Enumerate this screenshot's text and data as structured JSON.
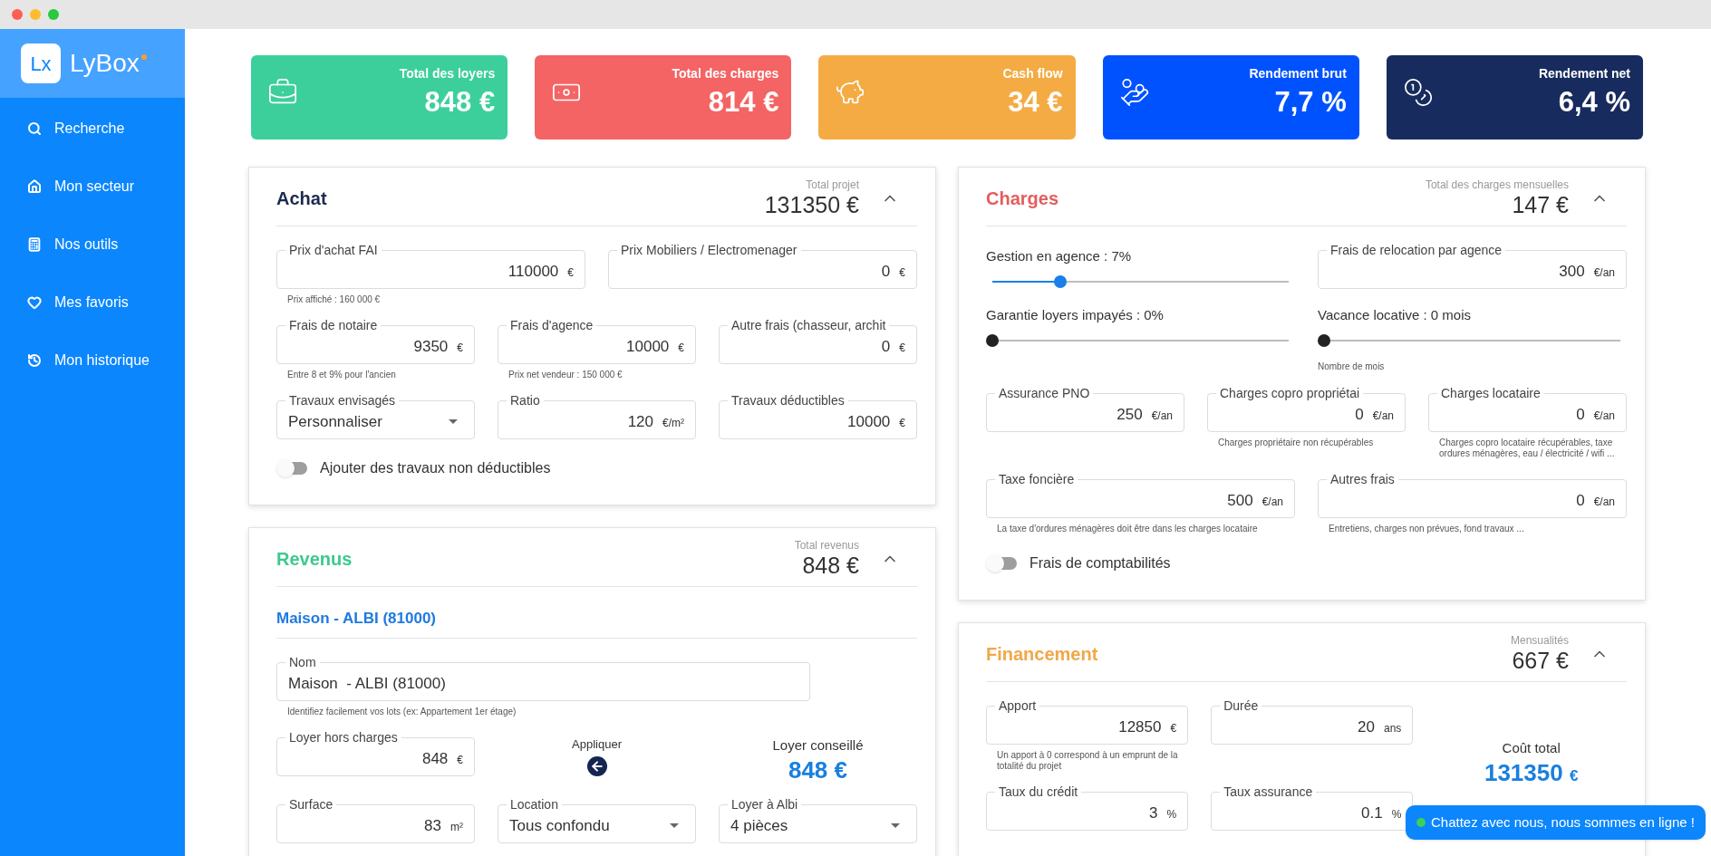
{
  "sidebar": {
    "logo": {
      "mark": "Lx",
      "name": "LyBox"
    },
    "items": [
      {
        "label": "Recherche"
      },
      {
        "label": "Mon secteur"
      },
      {
        "label": "Nos outils"
      },
      {
        "label": "Mes favoris"
      },
      {
        "label": "Mon historique"
      }
    ]
  },
  "kpis": [
    {
      "label": "Total des loyers",
      "value": "848 €",
      "color": "#3ccf9c"
    },
    {
      "label": "Total des charges",
      "value": "814 €",
      "color": "#f46464"
    },
    {
      "label": "Cash flow",
      "value": "34 €",
      "color": "#f4ab43"
    },
    {
      "label": "Rendement brut",
      "value": "7,7 %",
      "color": "#0052ff"
    },
    {
      "label": "Rendement net",
      "value": "6,4 %",
      "color": "#172b5e"
    }
  ],
  "columns": [
    [
      {
        "title": "Achat",
        "color": "#1b2a4e",
        "summary_label": "Total projet",
        "summary_value": "131350 €",
        "expanded": true,
        "rows": [
          [
            {
              "kind": "input",
              "label": "Prix d'achat FAI",
              "value": "110000",
              "unit": "€",
              "hint": "Prix affiché : 160 000 €"
            },
            {
              "kind": "input",
              "label": "Prix Mobiliers / Electromenager",
              "value": "0",
              "unit": "€"
            }
          ],
          [
            {
              "kind": "input",
              "label": "Frais de notaire",
              "value": "9350",
              "unit": "€",
              "hint": "Entre 8 et 9% pour l'ancien"
            },
            {
              "kind": "input",
              "label": "Frais d'agence",
              "value": "10000",
              "unit": "€",
              "hint": "Prix net vendeur : 150 000 €"
            },
            {
              "kind": "input",
              "label": "Autre frais (chasseur, archit",
              "value": "0",
              "unit": "€"
            }
          ],
          [
            {
              "kind": "select",
              "label": "Travaux envisagés",
              "value": "Personnaliser"
            },
            {
              "kind": "input",
              "label": "Ratio",
              "value": "120",
              "unit": "€/m²"
            },
            {
              "kind": "input",
              "label": "Travaux déductibles",
              "value": "10000",
              "unit": "€"
            }
          ],
          [
            {
              "kind": "toggle",
              "label": "Ajouter des travaux non déductibles",
              "on": false
            }
          ]
        ]
      },
      {
        "title": "Revenus",
        "color": "#3cc98f",
        "summary_label": "Total revenus",
        "summary_value": "848 €",
        "expanded": true,
        "subheading": "Maison - ALBI (81000)",
        "rows": [
          [
            {
              "kind": "text",
              "label": "Nom",
              "value": "Maison  - ALBI (81000)",
              "hint": "Identifiez facilement vos lots (ex: Appartement 1er étage)"
            }
          ],
          [
            {
              "kind": "input",
              "label": "Loyer hors charges",
              "value": "848",
              "unit": "€"
            },
            {
              "kind": "action",
              "label": "Appliquer"
            },
            {
              "kind": "stat",
              "label": "Loyer conseillé",
              "value": "848 €"
            }
          ],
          [
            {
              "kind": "input",
              "label": "Surface",
              "value": "83",
              "unit": "m²"
            },
            {
              "kind": "select",
              "label": "Location",
              "value": "Tous confondu"
            },
            {
              "kind": "select",
              "label": "Loyer à Albi",
              "value": "4 pièces"
            }
          ]
        ]
      }
    ],
    [
      {
        "title": "Charges",
        "color": "#e35d5d",
        "summary_label": "Total des charges mensuelles",
        "summary_value": "147 €",
        "expanded": true,
        "rows": [
          [
            {
              "kind": "slider",
              "label": "Gestion en agence : 7%",
              "level": 0.23
            },
            {
              "kind": "input",
              "label": "Frais de relocation par agence",
              "value": "300",
              "unit": "€/an"
            }
          ],
          [
            {
              "kind": "slider",
              "label": "Garantie loyers impayés : 0%",
              "level": 0
            },
            {
              "kind": "slider",
              "label": "Vacance locative : 0 mois",
              "level": 0,
              "hint": "Nombre de mois"
            }
          ],
          [
            {
              "kind": "input",
              "label": "Assurance PNO",
              "value": "250",
              "unit": "€/an"
            },
            {
              "kind": "input",
              "label": "Charges copro propriétai",
              "value": "0",
              "unit": "€/an",
              "hint": "Charges propriétaire non récupérables"
            },
            {
              "kind": "input",
              "label": "Charges locataire",
              "value": "0",
              "unit": "€/an",
              "hint": "Charges copro locataire récupérables, taxe ordures ménagères, eau / électricité / wifi ..."
            }
          ],
          [
            {
              "kind": "input",
              "label": "Taxe foncière",
              "value": "500",
              "unit": "€/an",
              "hint": "La taxe d'ordures ménagères doit être dans les charges locataire"
            },
            {
              "kind": "input",
              "label": "Autres frais",
              "value": "0",
              "unit": "€/an",
              "hint": "Entretiens, charges non prévues, fond travaux ..."
            }
          ],
          [
            {
              "kind": "toggle",
              "label": "Frais de comptabilités",
              "on": false
            }
          ]
        ]
      },
      {
        "title": "Financement",
        "color": "#f0a848",
        "summary_label": "Mensualités",
        "summary_value": "667 €",
        "expanded": true,
        "rows": [
          [
            {
              "kind": "input",
              "label": "Apport",
              "value": "12850",
              "unit": "€",
              "hint": "Un apport à 0 correspond à un emprunt de la totalité du projet"
            },
            {
              "kind": "input",
              "label": "Durée",
              "value": "20",
              "unit": "ans"
            }
          ],
          [
            {
              "kind": "input",
              "label": "Taux du crédit",
              "value": "3",
              "unit": "%"
            },
            {
              "kind": "input",
              "label": "Taux assurance",
              "value": "0.1",
              "unit": "%"
            }
          ]
        ],
        "aside": {
          "label": "Coût total",
          "value": "131350",
          "unit": "€"
        }
      }
    ]
  ],
  "chat": {
    "label": "Chattez avec nous, nous sommes en ligne !"
  }
}
